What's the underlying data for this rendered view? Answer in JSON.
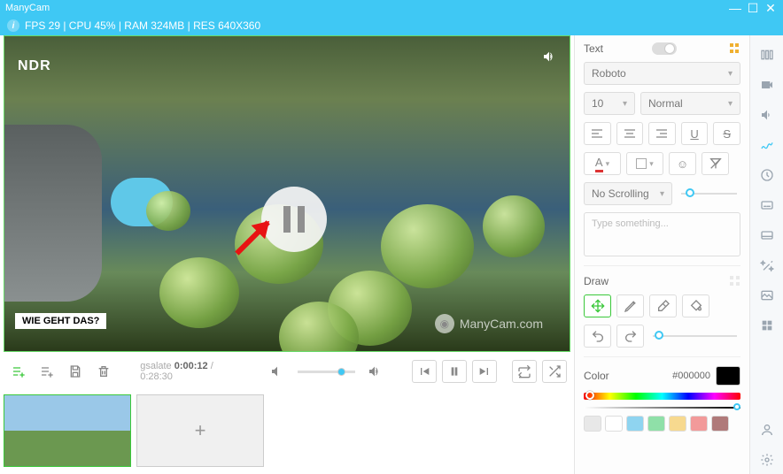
{
  "app": {
    "title": "ManyCam"
  },
  "stats": {
    "line": "FPS 29 | CPU 45% | RAM 324MB | RES 640X360"
  },
  "video": {
    "broadcaster_logo": "NDR",
    "banner": "WIE GEHT DAS?",
    "watermark": "ManyCam.com"
  },
  "playback": {
    "filename_fragment": "gsalate",
    "current_time": "0:00:12",
    "total_time": "0:28:30"
  },
  "text_panel": {
    "title": "Text",
    "font": "Roboto",
    "size": "10",
    "weight": "Normal",
    "scroll": "No Scrolling",
    "placeholder": "Type something..."
  },
  "draw_panel": {
    "title": "Draw"
  },
  "color_panel": {
    "title": "Color",
    "hex": "#000000",
    "swatches": [
      "#e8e8e8",
      "#ffffff",
      "#8fd4f0",
      "#8fe0a8",
      "#f7d98f",
      "#f29a9a",
      "#b07a7a"
    ]
  },
  "rail": {
    "items": [
      "presets",
      "camera",
      "audio",
      "draw",
      "time",
      "subtitle",
      "lower-third",
      "effects",
      "stretch",
      "grid"
    ],
    "bottom": [
      "user",
      "settings"
    ]
  }
}
